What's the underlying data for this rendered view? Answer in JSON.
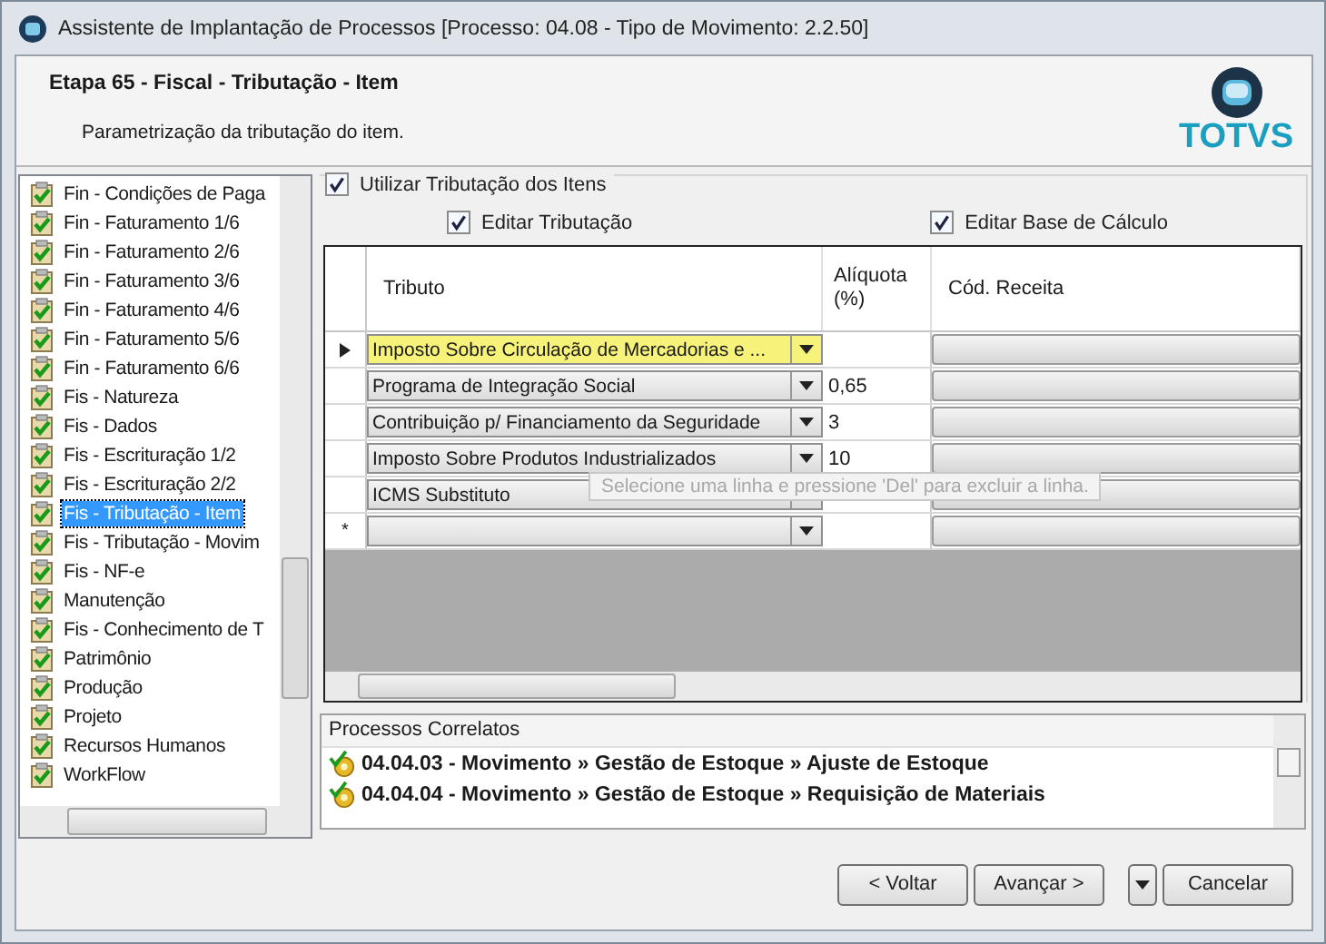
{
  "window": {
    "title": "Assistente de Implantação de Processos [Processo: 04.08 - Tipo de Movimento: 2.2.50]"
  },
  "header": {
    "title": "Etapa 65 - Fiscal - Tributação - Item",
    "subtitle": "Parametrização da tributação do item.",
    "logo_text": "TOTVS"
  },
  "steps": [
    {
      "label": "Fin - Condições de Paga",
      "selected": false
    },
    {
      "label": "Fin - Faturamento 1/6",
      "selected": false
    },
    {
      "label": "Fin - Faturamento 2/6",
      "selected": false
    },
    {
      "label": "Fin - Faturamento 3/6",
      "selected": false
    },
    {
      "label": "Fin - Faturamento 4/6",
      "selected": false
    },
    {
      "label": "Fin - Faturamento 5/6",
      "selected": false
    },
    {
      "label": "Fin - Faturamento 6/6",
      "selected": false
    },
    {
      "label": "Fis - Natureza",
      "selected": false
    },
    {
      "label": "Fis - Dados",
      "selected": false
    },
    {
      "label": "Fis - Escrituração 1/2",
      "selected": false
    },
    {
      "label": "Fis - Escrituração 2/2",
      "selected": false
    },
    {
      "label": "Fis - Tributação - Item",
      "selected": true
    },
    {
      "label": "Fis - Tributação - Movim",
      "selected": false
    },
    {
      "label": "Fis - NF-e",
      "selected": false
    },
    {
      "label": "Manutenção",
      "selected": false
    },
    {
      "label": "Fis - Conhecimento de T",
      "selected": false
    },
    {
      "label": "Patrimônio",
      "selected": false
    },
    {
      "label": "Produção",
      "selected": false
    },
    {
      "label": "Projeto",
      "selected": false
    },
    {
      "label": "Recursos Humanos",
      "selected": false
    },
    {
      "label": "WorkFlow",
      "selected": false
    }
  ],
  "group_checkbox": {
    "label": "Utilizar Tributação dos Itens",
    "checked": true
  },
  "edit_checkboxes": [
    {
      "label": "Editar Tributação",
      "checked": true
    },
    {
      "label": "Editar Base de Cálculo",
      "checked": true
    }
  ],
  "grid": {
    "columns": [
      "Tributo",
      "Alíquota (%)",
      "Cód. Receita"
    ],
    "rows": [
      {
        "tributo": "Imposto Sobre Circulação de Mercadorias e ...",
        "aliquota": "",
        "current": true,
        "highlighted": true
      },
      {
        "tributo": "Programa de Integração Social",
        "aliquota": "0,65",
        "current": false,
        "highlighted": false
      },
      {
        "tributo": "Contribuição p/ Financiamento da Seguridade",
        "aliquota": "3",
        "current": false,
        "highlighted": false
      },
      {
        "tributo": "Imposto Sobre Produtos Industrializados",
        "aliquota": "10",
        "current": false,
        "highlighted": false
      },
      {
        "tributo": "ICMS Substituto",
        "aliquota": "",
        "current": false,
        "highlighted": false
      }
    ],
    "new_row_marker": "*"
  },
  "tooltip": "Selecione uma linha e pressione 'Del' para excluir a linha.",
  "related": {
    "title": "Processos Correlatos",
    "items": [
      "04.04.03 - Movimento » Gestão de Estoque » Ajuste de Estoque",
      "04.04.04 - Movimento » Gestão de Estoque » Requisição de Materiais"
    ]
  },
  "buttons": [
    {
      "kind": "button",
      "label": "< Voltar"
    },
    {
      "kind": "button",
      "label": "Avançar >"
    },
    {
      "kind": "dropdown"
    },
    {
      "kind": "button",
      "label": "Cancelar"
    }
  ]
}
